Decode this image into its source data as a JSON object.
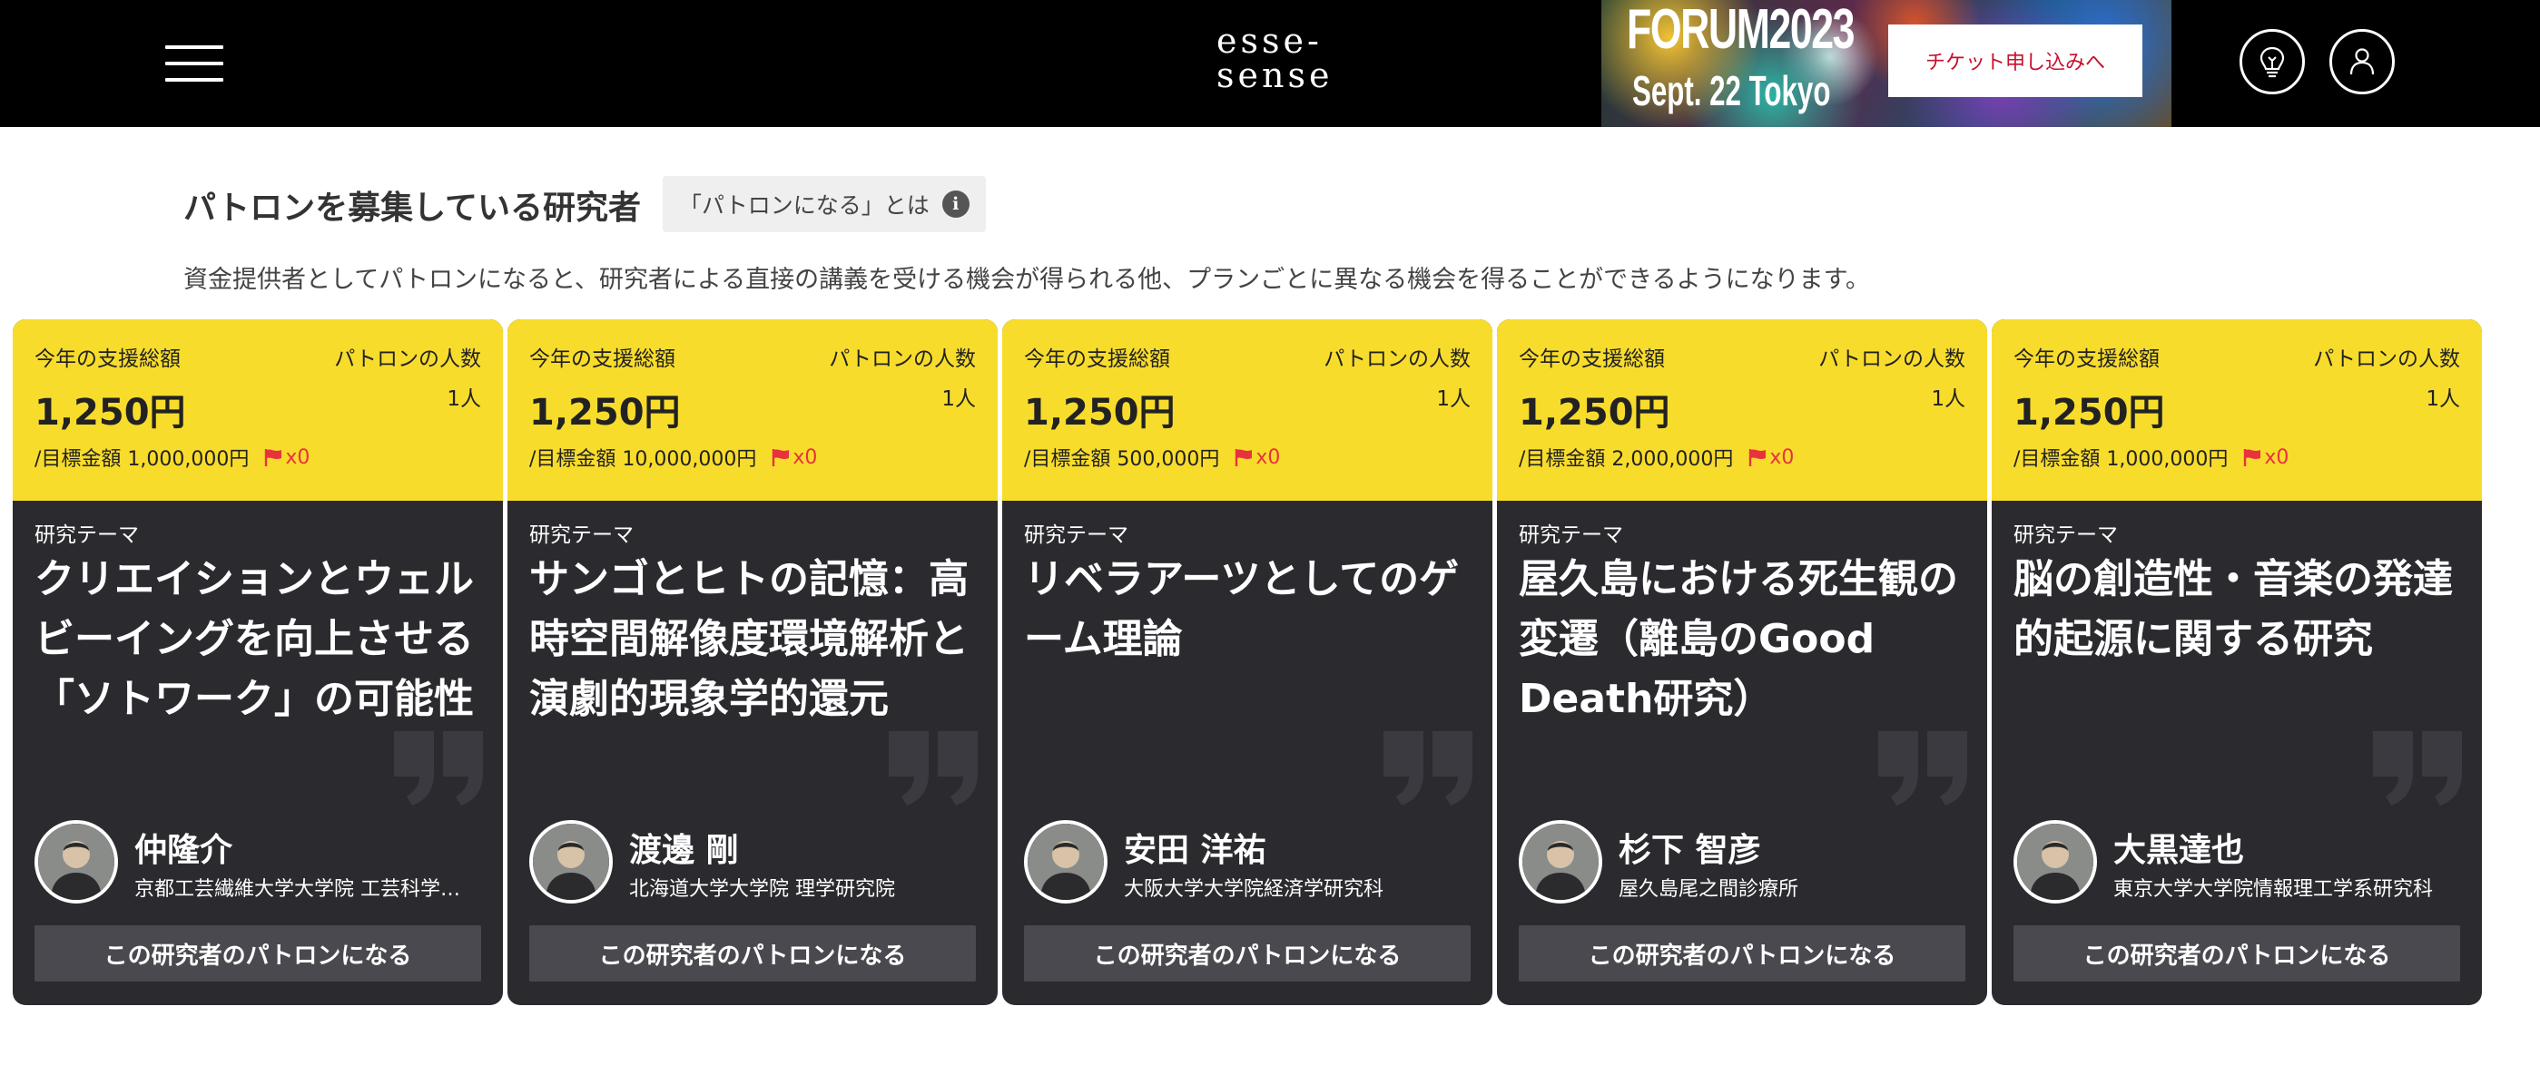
{
  "header": {
    "logo": "esse-\nsense",
    "logo_line1": "esse-",
    "logo_line2": "sense",
    "banner": {
      "title": "FORUM2023",
      "subtitle": "Sept. 22   Tokyo"
    },
    "ticket_label": "チケット申し込みへ",
    "icons": [
      "menu-icon",
      "lightbulb-icon",
      "user-icon"
    ]
  },
  "section": {
    "title": "パトロンを募集している研究者",
    "about_label": "「パトロンになる」とは",
    "description": "資金提供者としてパトロンになると、研究者による直接の講義を受ける機会が得られる他、プランごとに異なる機会を得ることができるようになります。"
  },
  "card_labels": {
    "total": "今年の支援総額",
    "patrons": "パトロンの人数",
    "theme": "研究テーマ",
    "button": "この研究者のパトロンになる"
  },
  "cards": [
    {
      "amount": "1,250円",
      "patron_count": "1人",
      "goal": "/目標金額 1,000,000円",
      "flags": "x0",
      "theme": "クリエイションとウェルビーイングを向上させる「ソトワーク」の可能性",
      "name": "仲隆介",
      "affiliation": "京都工芸繊維大学大学院 工芸科学研究科"
    },
    {
      "amount": "1,250円",
      "patron_count": "1人",
      "goal": "/目標金額 10,000,000円",
      "flags": "x0",
      "theme": "サンゴとヒトの記憶：高時空間解像度環境解析と演劇的現象学的還元",
      "name": "渡邊 剛",
      "affiliation": "北海道大学大学院 理学研究院"
    },
    {
      "amount": "1,250円",
      "patron_count": "1人",
      "goal": "/目標金額 500,000円",
      "flags": "x0",
      "theme": "リベラアーツとしてのゲーム理論",
      "name": "安田 洋祐",
      "affiliation": "大阪大学大学院経済学研究科"
    },
    {
      "amount": "1,250円",
      "patron_count": "1人",
      "goal": "/目標金額 2,000,000円",
      "flags": "x0",
      "theme": "屋久島における死生観の変遷（離島のGood Death研究）",
      "name": "杉下 智彦",
      "affiliation": "屋久島尾之間診療所"
    },
    {
      "amount": "1,250円",
      "patron_count": "1人",
      "goal": "/目標金額 1,000,000円",
      "flags": "x0",
      "theme": "脳の創造性・音楽の発達的起源に関する研究",
      "name": "大黒達也",
      "affiliation": "東京大学大学院情報理工学系研究科"
    }
  ],
  "colors": {
    "header_bg": "#000000",
    "card_top": "#f8dc2c",
    "card_body": "#2b2a2f",
    "button_bg": "#4a494f",
    "accent_red": "#c8102e",
    "flag_red": "#e8323e"
  }
}
